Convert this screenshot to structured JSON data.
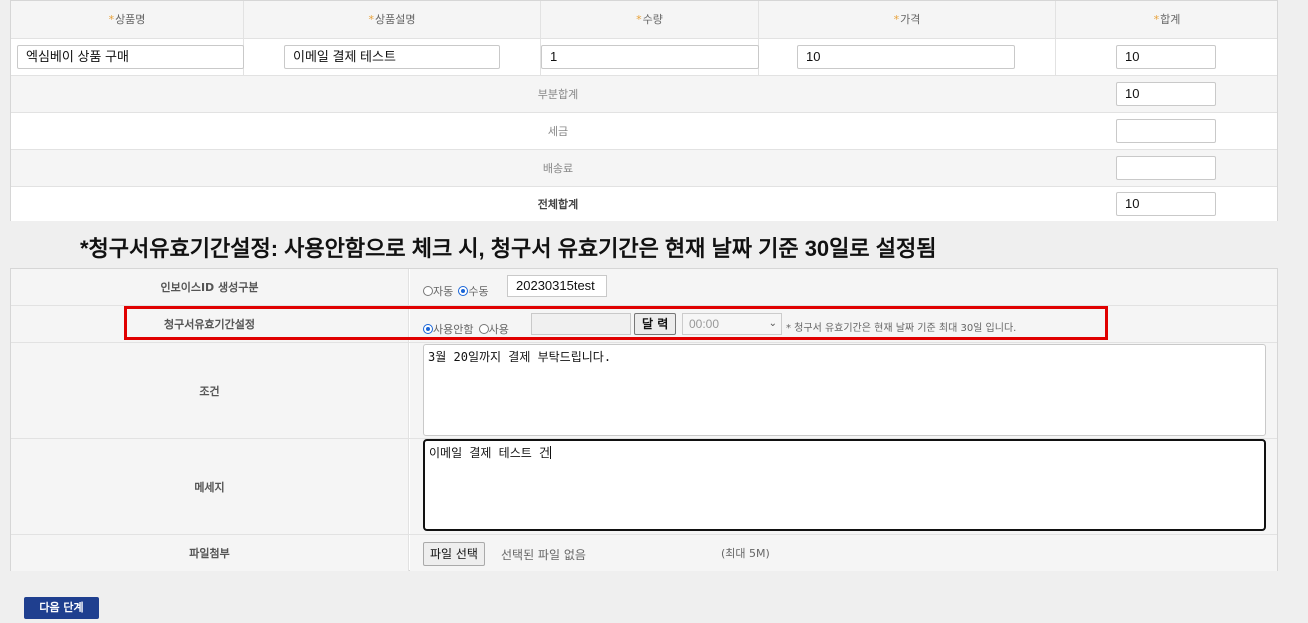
{
  "product_table": {
    "headers": [
      {
        "req": "*",
        "label": "상품명"
      },
      {
        "req": "*",
        "label": "상품설명"
      },
      {
        "req": "*",
        "label": "수량"
      },
      {
        "req": "*",
        "label": "가격"
      },
      {
        "req": "*",
        "label": "합계"
      }
    ],
    "item": {
      "name": "엑심베이 상품 구매",
      "description": "이메일 결제 테스트",
      "quantity": "1",
      "price": "10",
      "total": "10"
    },
    "summary": [
      {
        "label": "부분합계",
        "value": "10"
      },
      {
        "label": "세금",
        "value": ""
      },
      {
        "label": "배송료",
        "value": ""
      },
      {
        "label": "전체합계",
        "value": "10"
      }
    ]
  },
  "notice": "*청구서유효기간설정: 사용안함으로 체크 시, 청구서 유효기간은 현재 날짜 기준 30일로 설정됨",
  "invoice_form": {
    "invoice_id": {
      "label": "인보이스ID 생성구분",
      "option_auto": "자동",
      "option_manual": "수동",
      "selected": "manual",
      "value": "20230315test"
    },
    "validity": {
      "label": "청구서유효기간설정",
      "option_unused": "사용안함",
      "option_used": "사용",
      "selected": "unused",
      "date_value": "",
      "calendar_button": "달 력",
      "time_value": "00:00",
      "hint": "* 청구서 유효기간은 현재 날짜 기준 최대 30일 입니다."
    },
    "condition": {
      "label": "조건",
      "value": "3월 20일까지 결제 부탁드립니다."
    },
    "message": {
      "label": "메세지",
      "value": "이메일 결제 테스트 건"
    },
    "attachment": {
      "label": "파일첨부",
      "button": "파일 선택",
      "status": "선택된 파일 없음",
      "max_size": "(최대 5M)"
    }
  },
  "next_button": "다음 단계",
  "colors": {
    "required_mark": "#e8a23a",
    "highlight_box": "#e00000",
    "next_button": "#1f3f8f"
  }
}
